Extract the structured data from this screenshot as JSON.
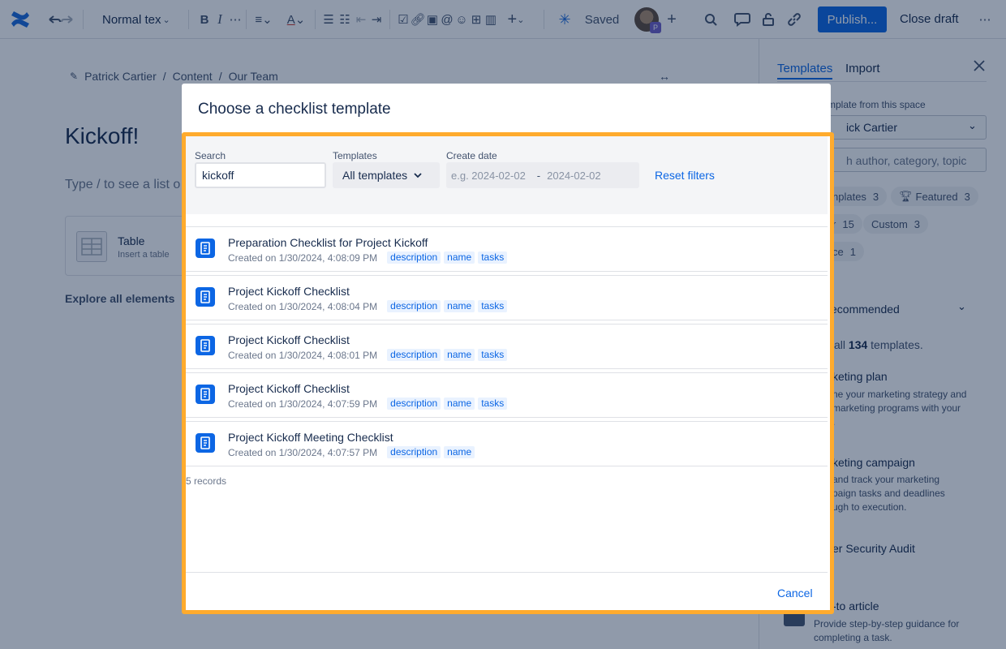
{
  "toolbar": {
    "text_style": "Normal tex",
    "saved_label": "Saved",
    "avatar_badge": "P",
    "publish_label": "Publish...",
    "close_draft_label": "Close draft"
  },
  "breadcrumb": [
    "Patrick Cartier",
    "Content",
    "Our Team"
  ],
  "page": {
    "title": "Kickoff!",
    "hint": "Type / to see a list o",
    "element_card": {
      "title": "Table",
      "subtitle": "Insert a table"
    },
    "explore_label": "Explore all elements"
  },
  "side_panel": {
    "tabs": [
      "Templates",
      "Import"
    ],
    "space_label": "mplate from this space",
    "space_value": "ick Cartier",
    "search_placeholder": "h author, category, topic",
    "chips": [
      {
        "label": "nplates",
        "count": "3"
      },
      {
        "label": "Featured",
        "count": "3"
      },
      {
        "label": "r",
        "count": "15"
      },
      {
        "label": "Custom",
        "count": "3"
      },
      {
        "label": "ce",
        "count": "1"
      }
    ],
    "sort_label": "ecommended",
    "total_text_prefix": "all",
    "total_count": "134",
    "total_text_suffix": "templates.",
    "items": [
      {
        "title": "keting plan",
        "desc": [
          "ne your marketing strategy and",
          "marketing programs with your",
          "."
        ]
      },
      {
        "title": "keting campaign",
        "desc": [
          "and track your marketing",
          "paign tasks and deadlines",
          "ugh to execution."
        ]
      },
      {
        "title": "er Security Audit",
        "desc": []
      },
      {
        "title": "-to article",
        "desc": [
          "Provide step-by-step guidance for",
          "completing a task."
        ]
      }
    ]
  },
  "modal": {
    "title": "Choose a checklist template",
    "filters": {
      "search_label": "Search",
      "search_value": "kickoff",
      "templates_label": "Templates",
      "templates_value": "All templates",
      "date_label": "Create date",
      "date_from_placeholder": "e.g. 2024-02-02",
      "date_separator": "-",
      "date_to_placeholder": "2024-02-02",
      "reset_label": "Reset filters"
    },
    "results": [
      {
        "title": "Preparation Checklist for Project Kickoff",
        "meta": "Created on 1/30/2024, 4:08:09 PM",
        "tags": [
          "description",
          "name",
          "tasks"
        ]
      },
      {
        "title": "Project Kickoff Checklist",
        "meta": "Created on 1/30/2024, 4:08:04 PM",
        "tags": [
          "description",
          "name",
          "tasks"
        ]
      },
      {
        "title": "Project Kickoff Checklist",
        "meta": "Created on 1/30/2024, 4:08:01 PM",
        "tags": [
          "description",
          "name",
          "tasks"
        ]
      },
      {
        "title": "Project Kickoff Checklist",
        "meta": "Created on 1/30/2024, 4:07:59 PM",
        "tags": [
          "description",
          "name",
          "tasks"
        ]
      },
      {
        "title": "Project Kickoff Meeting Checklist",
        "meta": "Created on 1/30/2024, 4:07:57 PM",
        "tags": [
          "description",
          "name"
        ]
      }
    ],
    "records_label": "5 records",
    "cancel_label": "Cancel"
  },
  "colors": {
    "accent": "#0c66e4",
    "highlight": "#ffab2d",
    "overlay": "#091e42"
  }
}
